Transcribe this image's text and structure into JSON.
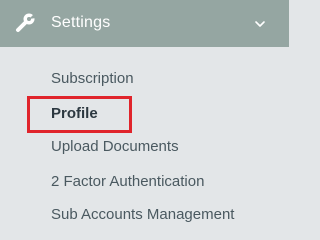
{
  "settings_menu": {
    "header": {
      "icon": "wrench-icon",
      "title": "Settings",
      "toggle_icon": "chevron-down-icon",
      "background_color": "#95a6a2"
    },
    "items": [
      {
        "label": "Subscription",
        "active": false
      },
      {
        "label": "Profile",
        "active": true
      },
      {
        "label": "Upload Documents",
        "active": false
      },
      {
        "label": "2 Factor Authentication",
        "active": false
      },
      {
        "label": "Sub Accounts Management",
        "active": false
      }
    ],
    "highlight_color": "#e0242b"
  }
}
